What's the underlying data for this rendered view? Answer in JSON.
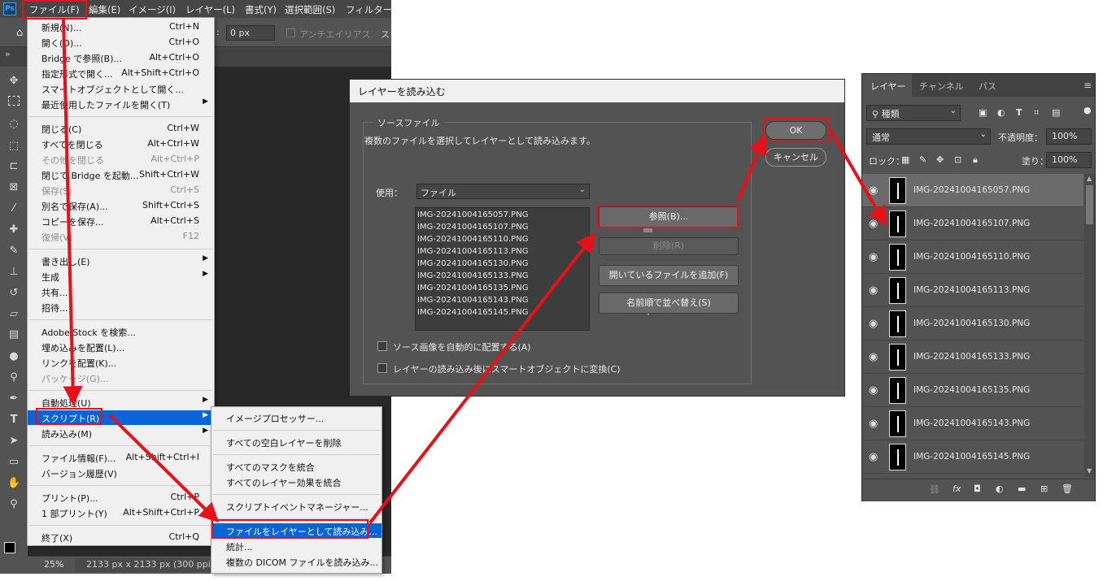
{
  "menubar": {
    "logo": "Ps",
    "items": [
      "ファイル(F)",
      "編集(E)",
      "イメージ(I)",
      "レイヤー(L)",
      "書式(Y)",
      "選択範囲(S)",
      "フィルター"
    ]
  },
  "options_bar": {
    "feather_value": "0 px",
    "antialias_label": "アンチエイリアス",
    "style_label": "ス"
  },
  "status_bar": {
    "zoom": "25%",
    "doc_info": "2133 px x 2133 px (300 ppi)"
  },
  "file_menu": {
    "items": [
      {
        "label": "新規(N)...",
        "shortcut": "Ctrl+N"
      },
      {
        "label": "開く(O)...",
        "shortcut": "Ctrl+O"
      },
      {
        "label": "Bridge で参照(B)...",
        "shortcut": "Alt+Ctrl+O"
      },
      {
        "label": "指定形式で開く...",
        "shortcut": "Alt+Shift+Ctrl+O"
      },
      {
        "label": "スマートオブジェクトとして開く...",
        "shortcut": ""
      },
      {
        "label": "最近使用したファイルを開く(T)",
        "shortcut": ""
      },
      {
        "label": "閉じる(C)",
        "shortcut": "Ctrl+W"
      },
      {
        "label": "すべてを閉じる",
        "shortcut": "Alt+Ctrl+W"
      },
      {
        "label": "その他を閉じる",
        "shortcut": "Alt+Ctrl+P"
      },
      {
        "label": "閉じて Bridge を起動...",
        "shortcut": "Shift+Ctrl+W"
      },
      {
        "label": "保存(S)",
        "shortcut": "Ctrl+S"
      },
      {
        "label": "別名で保存(A)...",
        "shortcut": "Shift+Ctrl+S"
      },
      {
        "label": "コピーを保存...",
        "shortcut": "Alt+Ctrl+S"
      },
      {
        "label": "復帰(V)",
        "shortcut": "F12"
      },
      {
        "label": "書き出し(E)",
        "shortcut": ""
      },
      {
        "label": "生成",
        "shortcut": ""
      },
      {
        "label": "共有...",
        "shortcut": ""
      },
      {
        "label": "招待...",
        "shortcut": ""
      },
      {
        "label": "Adobe Stock を検索...",
        "shortcut": ""
      },
      {
        "label": "埋め込みを配置(L)...",
        "shortcut": ""
      },
      {
        "label": "リンクを配置(K)...",
        "shortcut": ""
      },
      {
        "label": "パッケージ(G)...",
        "shortcut": ""
      },
      {
        "label": "自動処理(U)",
        "shortcut": ""
      },
      {
        "label": "スクリプト(R)",
        "shortcut": ""
      },
      {
        "label": "読み込み(M)",
        "shortcut": ""
      },
      {
        "label": "ファイル情報(F)...",
        "shortcut": "Alt+Shift+Ctrl+I"
      },
      {
        "label": "バージョン履歴(V)",
        "shortcut": ""
      },
      {
        "label": "プリント(P)...",
        "shortcut": "Ctrl+P"
      },
      {
        "label": "1 部プリント(Y)",
        "shortcut": "Alt+Shift+Ctrl+P"
      },
      {
        "label": "終了(X)",
        "shortcut": "Ctrl+Q"
      }
    ]
  },
  "script_submenu": {
    "items": [
      "イメージプロセッサー...",
      "すべての空白レイヤーを削除",
      "すべてのマスクを統合",
      "すべてのレイヤー効果を統合",
      "スクリプトイベントマネージャー...",
      "ファイルをレイヤーとして読み込み...",
      "統計...",
      "複数の DICOM ファイルを読み込み..."
    ]
  },
  "dialog": {
    "title": "レイヤーを読み込む",
    "group_label": "ソースファイル",
    "description": "複数のファイルを選択してレイヤーとして読み込みます。",
    "use_label": "使用：",
    "use_value": "ファイル",
    "files": [
      "IMG-20241004165057.PNG",
      "IMG-20241004165107.PNG",
      "IMG-20241004165110.PNG",
      "IMG-20241004165113.PNG",
      "IMG-20241004165130.PNG",
      "IMG-20241004165133.PNG",
      "IMG-20241004165135.PNG",
      "IMG-20241004165143.PNG",
      "IMG-20241004165145.PNG"
    ],
    "browse_label": "参照(B)...",
    "remove_label": "削除(R)",
    "add_open_label": "開いているファイルを追加(F)",
    "sort_label": "名前順で並べ替え(S)",
    "auto_align_label": "ソース画像を自動的に配置する(A)",
    "smart_object_label": "レイヤーの読み込み後にスマートオブジェクトに変換(C)",
    "ok_label": "OK",
    "cancel_label": "キャンセル"
  },
  "layers_panel": {
    "tabs": [
      "レイヤー",
      "チャンネル",
      "パス"
    ],
    "filter_kind": "種類",
    "blend_mode": "通常",
    "opacity_label": "不透明度：",
    "opacity_value": "100%",
    "lock_label": "ロック：",
    "fill_label": "塗り：",
    "fill_value": "100%",
    "layers": [
      "IMG-20241004165057.PNG",
      "IMG-20241004165107.PNG",
      "IMG-20241004165110.PNG",
      "IMG-20241004165113.PNG",
      "IMG-20241004165130.PNG",
      "IMG-20241004165133.PNG",
      "IMG-20241004165135.PNG",
      "IMG-20241004165143.PNG",
      "IMG-20241004165145.PNG"
    ]
  },
  "colors": {
    "highlight": "#0a64d6",
    "annotation_red": "#e8101a"
  }
}
